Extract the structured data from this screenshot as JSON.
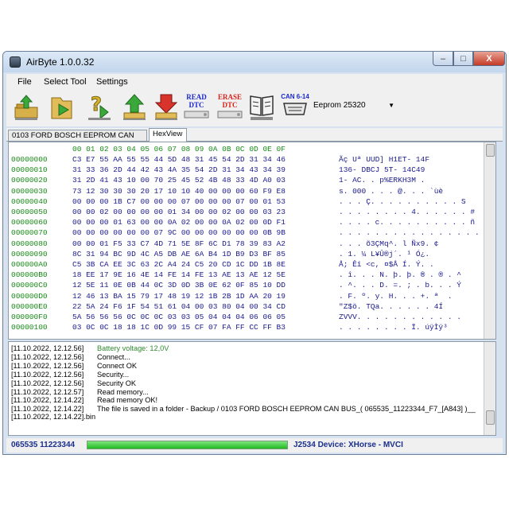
{
  "window": {
    "title": "AirByte 1.0.0.32",
    "min": "–",
    "max": "□",
    "close": "X"
  },
  "menu": [
    "File",
    "Select Tool",
    "Settings"
  ],
  "toolbar": {
    "read_dtc": [
      "READ",
      "DTC"
    ],
    "erase_dtc": [
      "ERASE",
      "DTC"
    ],
    "can_label": "CAN 6-14",
    "eeprom_value": "Eeprom 25320",
    "icons": [
      "open-folder-icon",
      "folder-arrow-icon",
      "question-arrow-icon",
      "upload-arrow-icon",
      "download-arrow-icon",
      "read-dtc-icon",
      "erase-dtc-icon",
      "book-icon",
      "can-connector-icon"
    ]
  },
  "tabs": [
    "0103 FORD BOSCH EEPROM CAN BUS",
    "HexView"
  ],
  "hex": {
    "header": "00 01 02 03 04 05 06 07 08 09 0A 0B 0C 0D 0E 0F",
    "rows": [
      {
        "addr": "00000000",
        "bytes": "C3 E7 55 AA 55 55 44 5D 48 31 45 54 2D 31 34 46",
        "ascii": "Ãç Uª UUD] H1ET- 14F"
      },
      {
        "addr": "00000010",
        "bytes": "31 33 36 2D 44 42 43 4A 35 54 2D 31 34 43 34 39",
        "ascii": "136- DBCJ 5T- 14C49"
      },
      {
        "addr": "00000020",
        "bytes": "31 2D 41 43 10 00 70 25 45 52 4B 48 33 4D A0 03",
        "ascii": "1- AC. . p%ERKH3M ."
      },
      {
        "addr": "00000030",
        "bytes": "73 12 30 30 30 20 17 10 10 40 00 00 00 60 F9 E8",
        "ascii": "s. 000 . . . @. . . `ùè"
      },
      {
        "addr": "00000040",
        "bytes": "00 00 00 1B C7 00 00 00 07 00 00 00 07 00 01 53",
        "ascii": ". . . Ç. . . . . . . . . . S"
      },
      {
        "addr": "00000050",
        "bytes": "00 00 02 00 00 00 00 01 34 00 00 02 00 00 03 23",
        "ascii": ". . . . . . . . 4. . . . . . #"
      },
      {
        "addr": "00000060",
        "bytes": "00 00 00 01 63 00 00 0A 02 00 00 0A 02 00 0D F1",
        "ascii": ". . . . c. . . . . . . . . . ñ"
      },
      {
        "addr": "00000070",
        "bytes": "00 00 00 00 00 00 07 9C 00 00 00 00 00 00 0B 9B",
        "ascii": ". . . . . . . . . . . . . . . ."
      },
      {
        "addr": "00000080",
        "bytes": "00 00 01 F5 33 C7 4D 71 5E 8F 6C D1 78 39 83 A2",
        "ascii": ". . . õ3ÇMq^. l Ñx9. ¢"
      },
      {
        "addr": "00000090",
        "bytes": "8C 31 94 BC 9D 4C A5 DB AE 6A B4 1D B9 D3 BF 85",
        "ascii": ". 1. ¼ L¥Û®j´. ¹ Ó¿."
      },
      {
        "addr": "000000A0",
        "bytes": "C5 3B CA EE 3C 63 2C A4 24 C5 20 CD 1C DD 1B 8E",
        "ascii": "Å; Êî <c, ¤$Å Í. Ý. ."
      },
      {
        "addr": "000000B0",
        "bytes": "18 EE 17 9E 16 4E 14 FE 14 FE 13 AE 13 AE 12 5E",
        "ascii": ". î. . . N. þ. þ. ® . ® . ^"
      },
      {
        "addr": "000000C0",
        "bytes": "12 5E 11 0E 0B 44 0C 3D 0D 3B 0E 62 0F 85 10 DD",
        "ascii": ". ^. . . D. =. ; . b. . . Ý"
      },
      {
        "addr": "000000D0",
        "bytes": "12 46 13 BA 15 79 17 48 19 12 1B 2B 1D AA 20 19",
        "ascii": ". F. º. y. H. . . +. ª  ."
      },
      {
        "addr": "000000E0",
        "bytes": "22 5A 24 F6 1F 54 51 61 04 00 03 80 04 00 34 CD",
        "ascii": "\"Z$ö. TQa. . . . . . 4Í"
      },
      {
        "addr": "000000F0",
        "bytes": "5A 56 56 56 0C 0C 0C 03 03 05 04 04 04 06 06 05",
        "ascii": "ZVVV. . . . . . . . . . . ."
      },
      {
        "addr": "00000100",
        "bytes": "03 0C 0C 18 18 1C 0D 99 15 CF 07 FA FF CC FF B3",
        "ascii": ". . . . . . . . Ï. úÿÌÿ³"
      }
    ]
  },
  "log": {
    "rows": [
      {
        "time": "[11.10.2022, 12.12.56]",
        "msg": "Battery voltage: 12,0V",
        "color": "#2e8b2e"
      },
      {
        "time": "[11.10.2022, 12.12.56]",
        "msg": "Connect...",
        "color": "#000000"
      },
      {
        "time": "[11.10.2022, 12.12.56]",
        "msg": "Connect OK",
        "color": "#000000"
      },
      {
        "time": "[11.10.2022, 12.12.56]",
        "msg": "Security...",
        "color": "#000000"
      },
      {
        "time": "[11.10.2022, 12.12.56]",
        "msg": "Security OK",
        "color": "#000000"
      },
      {
        "time": "[11.10.2022, 12.12.57]",
        "msg": "Read memory...",
        "color": "#000000"
      },
      {
        "time": "[11.10.2022, 12.14.22]",
        "msg": "Read memory OK!",
        "color": "#000000"
      },
      {
        "time": "[11.10.2022, 12.14.22]",
        "msg": "The file is saved in a folder - Backup / 0103 FORD BOSCH EEPROM CAN BUS_( 065535_11223344_F7_[A843] )__",
        "color": "#000000"
      }
    ],
    "wrap": "[11.10.2022, 12.14.22].bin"
  },
  "status": {
    "left": "065535   11223344",
    "progress": 1.0,
    "right": "J2534 Device: XHorse - MVCI"
  }
}
